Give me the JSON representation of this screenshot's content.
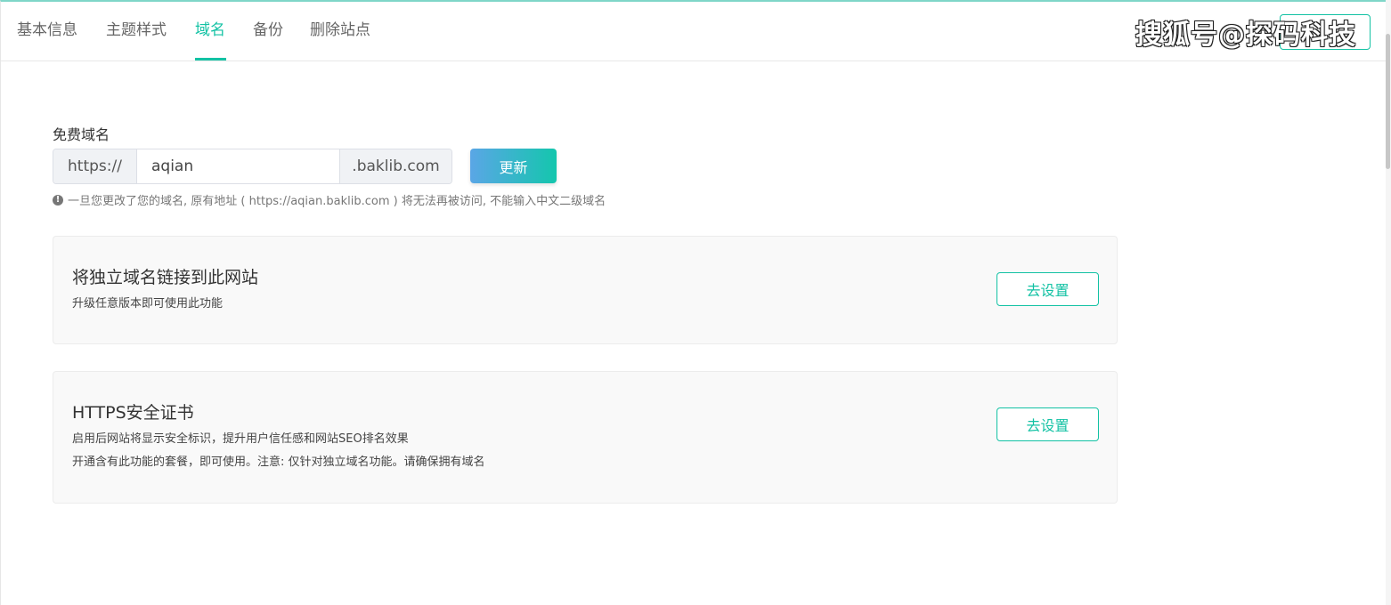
{
  "tabs": [
    {
      "label": "基本信息"
    },
    {
      "label": "主题样式"
    },
    {
      "label": "域名",
      "active": true
    },
    {
      "label": "备份"
    },
    {
      "label": "删除站点"
    }
  ],
  "watermark": "搜狐号@探码科技",
  "free_domain": {
    "label": "免费域名",
    "prefix": "https://",
    "value": "aqian",
    "suffix": ".baklib.com",
    "update_button": "更新",
    "hint": "一旦您更改了您的域名, 原有地址 ( https://aqian.baklib.com ) 将无法再被访问, 不能输入中文二级域名"
  },
  "custom_domain_card": {
    "title": "将独立域名链接到此网站",
    "desc": "升级任意版本即可使用此功能",
    "button": "去设置"
  },
  "https_card": {
    "title": "HTTPS安全证书",
    "desc_1": "启用后网站将显示安全标识，提升用户信任感和网站SEO排名效果",
    "desc_2": "开通含有此功能的套餐，即可使用。注意: 仅针对独立域名功能。请确保拥有域名",
    "button": "去设置"
  },
  "colors": {
    "accent": "#13c2a4",
    "gradient_start": "#5aa6e6",
    "gradient_end": "#14c6ad"
  }
}
